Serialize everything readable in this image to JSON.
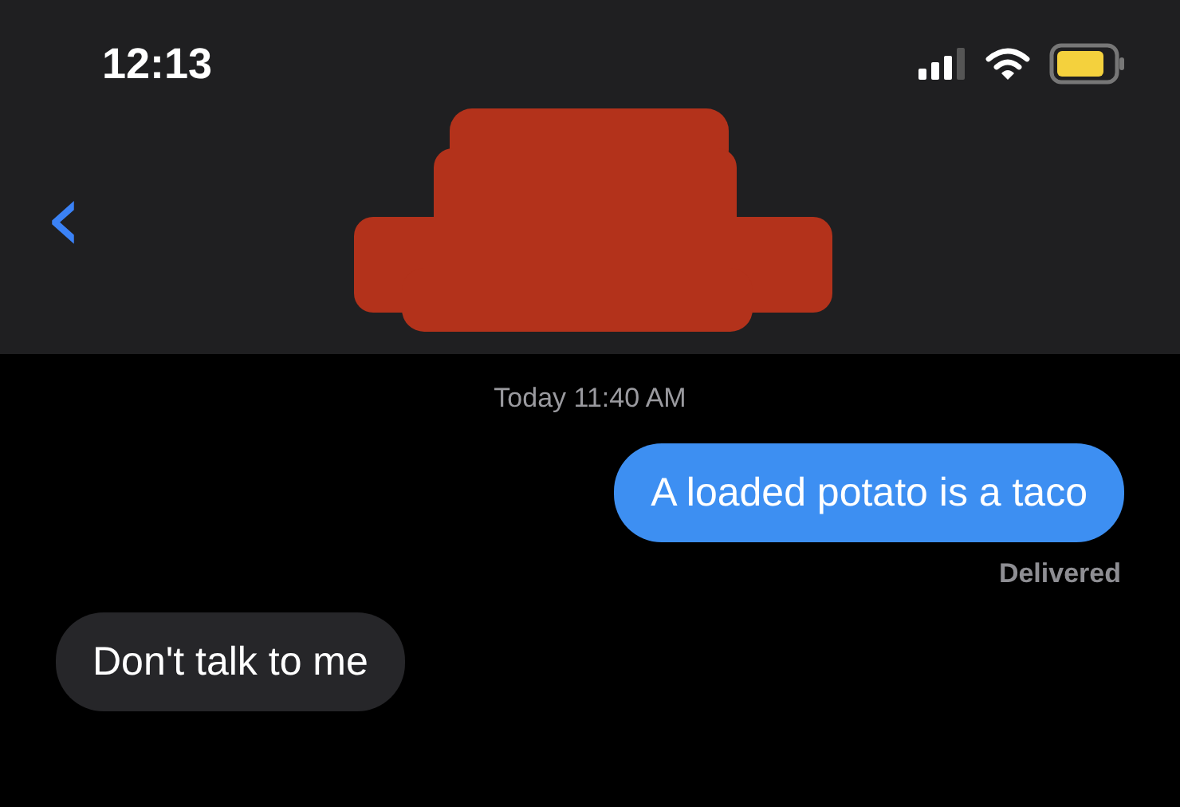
{
  "status_bar": {
    "time": "12:13"
  },
  "header": {
    "back": "‹"
  },
  "timestamp": "Today 11:40 AM",
  "messages": [
    {
      "kind": "sent",
      "text": "A loaded potato is a taco",
      "receipt": "Delivered"
    },
    {
      "kind": "received",
      "text": "Don't talk to me"
    }
  ]
}
